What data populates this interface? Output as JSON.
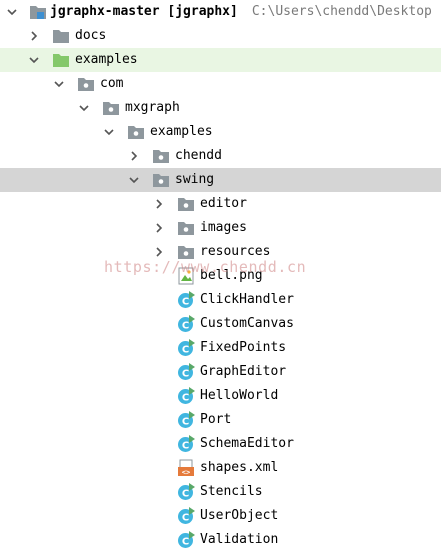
{
  "header": {
    "project_name": "jgraphx-master [jgraphx]",
    "project_path": "C:\\Users\\chendd\\Desktop"
  },
  "tree": [
    {
      "label": "docs",
      "type": "folder"
    },
    {
      "label": "examples",
      "type": "folder"
    },
    {
      "label": "com",
      "type": "package"
    },
    {
      "label": "mxgraph",
      "type": "package"
    },
    {
      "label": "examples",
      "type": "package"
    },
    {
      "label": "chendd",
      "type": "package"
    },
    {
      "label": "swing",
      "type": "package"
    },
    {
      "label": "editor",
      "type": "package"
    },
    {
      "label": "images",
      "type": "package"
    },
    {
      "label": "resources",
      "type": "package"
    },
    {
      "label": "bell.png",
      "type": "image-file"
    },
    {
      "label": "ClickHandler",
      "type": "class"
    },
    {
      "label": "CustomCanvas",
      "type": "class"
    },
    {
      "label": "FixedPoints",
      "type": "class"
    },
    {
      "label": "GraphEditor",
      "type": "class"
    },
    {
      "label": "HelloWorld",
      "type": "class"
    },
    {
      "label": "Port",
      "type": "class"
    },
    {
      "label": "SchemaEditor",
      "type": "class"
    },
    {
      "label": "shapes.xml",
      "type": "xml-file"
    },
    {
      "label": "Stencils",
      "type": "class"
    },
    {
      "label": "UserObject",
      "type": "class"
    },
    {
      "label": "Validation",
      "type": "class"
    }
  ],
  "watermark": "https://www.chendd.cn",
  "colors": {
    "folder": "#8e979d",
    "source_folder": "#84c86a",
    "class_icon": "#40b6e0",
    "run_marker": "#59a869",
    "selected_row": "#d5d5d5",
    "highlight_row": "#e9f6e3"
  }
}
